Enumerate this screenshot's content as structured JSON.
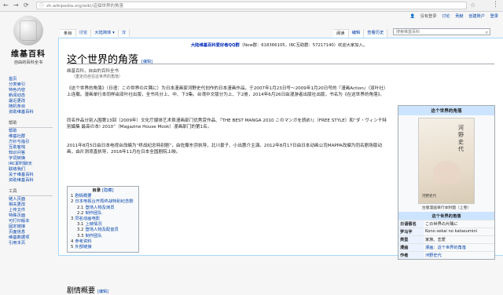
{
  "browser": {
    "url": "zh.wikipedia.org/wiki/這個世界的角落"
  },
  "personal_tools": [
    "没有登录",
    "讨论",
    "贡献",
    "创建账户",
    "登录"
  ],
  "logo": {
    "name": "维基百科",
    "tagline": "自由的百科全书"
  },
  "sidebar": {
    "nav": [
      "首页",
      "分类索引",
      "特色内容",
      "新闻动态",
      "最近更改",
      "随机条目",
      "资助维基百科"
    ],
    "help_head": "帮助",
    "help": [
      "帮助",
      "维基社群",
      "方针与指引",
      "互助客栈",
      "知识问答",
      "字词转换",
      "IRC即时聊天",
      "联络我们",
      "关于维基百科",
      "资助维基百科"
    ],
    "tools_head": "工具",
    "tools": [
      "链入页面",
      "相关更改",
      "上传文件",
      "特殊页面",
      "可打印版本",
      "固定链接",
      "页面信息",
      "维基数据项",
      "引用本页"
    ]
  },
  "tabs": {
    "left": [
      "条目",
      "讨论",
      "大陆简体",
      "汉"
    ],
    "right": [
      "阅读",
      "编辑",
      "查看历史"
    ]
  },
  "search": {
    "placeholder": "搜索维基百科"
  },
  "sitenotice": {
    "text": "大陆维基百科爱好者QQ群",
    "rest": "（New群：618366105，IRC互助群：57217140）欢迎大家加入。"
  },
  "page": {
    "title": "这个世界的角落",
    "edit": "[编辑]",
    "from": "维基百科，自由的百科全书",
    "redirect": "（重定向自在这世界的角落）",
    "p1": "《这个世界的角落》（日语：この世界の片隅に）为日本漫画家河野史代创作的日本漫画作品，于2007年1月23日号～2009年1月20日号的『漫画Action』（双叶社）上连载。漫画单行本同样由双叶社出版，全书共分上、中、下3集。台湾中文版分为上、下2册，2014年6月26日由漫游者出版社出版，书名为《在这世界的角落》。",
    "p2": "同名作品分别入围第13回（2009年）文化厅媒体艺术祭漫画部门优秀赏作品、『THE BEST MANGA 2010 このマンガを読め!』（FREE STYLE）和“ダ・ヴィンチ特別編集 最高の本! 2010”（Magazine House Mook）漫画部门的第1名。",
    "p3": "2011年8月5日由日本电视台改编为“终战纪念特别剧”，由佐藤东弥执导，北川景子、小出惠介主演。2012年8月17日由日本动画公司MAPPA改编为同名剧场版动画，由片渕须直执导，2016年11月在日本全国剧院上映。"
  },
  "toc": {
    "title": "目录",
    "hide": "[隐藏]",
    "items": [
      {
        "n": "1",
        "t": "剧情概要",
        "lvl": 1
      },
      {
        "n": "2",
        "t": "日本电视台开局终战特别纪念剧",
        "lvl": 1
      },
      {
        "n": "2.1",
        "t": "登场人物及演员",
        "lvl": 2
      },
      {
        "n": "2.2",
        "t": "制作团队",
        "lvl": 2
      },
      {
        "n": "3",
        "t": "同名动画电影",
        "lvl": 1
      },
      {
        "n": "3.1",
        "t": "上映情况",
        "lvl": 2
      },
      {
        "n": "3.2",
        "t": "登场人物及配音员",
        "lvl": 2
      },
      {
        "n": "3.3",
        "t": "制作团队",
        "lvl": 2
      },
      {
        "n": "4",
        "t": "参考资料",
        "lvl": 1
      },
      {
        "n": "5",
        "t": "外部链接",
        "lvl": 1
      }
    ]
  },
  "section": {
    "title": "剧情概要",
    "edit": "[编辑]"
  },
  "infobox": {
    "title": "这个世界的角落",
    "cover_caption": "台版漫画单行本封面（上卷）",
    "section": "这个世界的角落",
    "rows": [
      {
        "k": "日语假名",
        "v": "この世界の片隅に",
        "blue": false
      },
      {
        "k": "罗马字",
        "v": "Kono sekai no katasumini",
        "blue": false
      },
      {
        "k": "类型",
        "v": "家族、恋爱",
        "blue": false
      },
      {
        "k": "漫画",
        "v": "漫画：这个世界的角落",
        "blue": true
      },
      {
        "k": "作者",
        "v": "河野史代",
        "blue": true
      }
    ],
    "cover_text": {
      "a": "河",
      "b": "野",
      "c": "史",
      "d": "代",
      "pub": "河野史代"
    }
  }
}
